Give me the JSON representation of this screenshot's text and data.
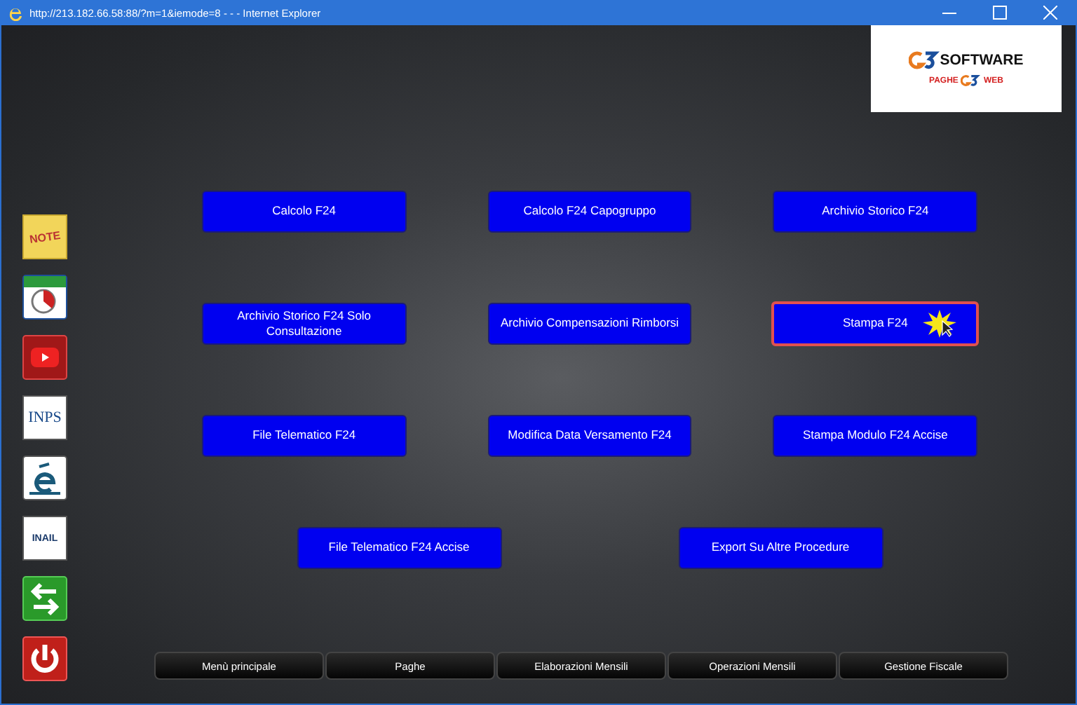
{
  "window": {
    "title": "http://213.182.66.58:88/?m=1&iemode=8 - - - Internet Explorer"
  },
  "logo": {
    "brand": "SOFTWARE",
    "left": "PAGHE",
    "right": "WEB"
  },
  "sidebar": [
    {
      "kind": "note",
      "text": "NOTE"
    },
    {
      "kind": "calendar"
    },
    {
      "kind": "video"
    },
    {
      "kind": "inps",
      "text": "INPS"
    },
    {
      "kind": "e"
    },
    {
      "kind": "inail",
      "text": "INAIL"
    },
    {
      "kind": "swap"
    },
    {
      "kind": "power"
    }
  ],
  "menu_rows": [
    [
      {
        "label": "Calcolo F24",
        "selected": false
      },
      {
        "label": "Calcolo F24 Capogruppo",
        "selected": false
      },
      {
        "label": "Archivio Storico F24",
        "selected": false
      }
    ],
    [
      {
        "label": "Archivio Storico F24 Solo Consultazione",
        "selected": false
      },
      {
        "label": "Archivio Compensazioni Rimborsi",
        "selected": false
      },
      {
        "label": "Stampa F24",
        "selected": true
      }
    ],
    [
      {
        "label": "File Telematico F24",
        "selected": false
      },
      {
        "label": "Modifica Data Versamento F24",
        "selected": false
      },
      {
        "label": "Stampa Modulo F24 Accise",
        "selected": false
      }
    ],
    [
      {
        "label": "File Telematico F24 Accise",
        "selected": false
      },
      {
        "label": "Export Su Altre Procedure",
        "selected": false
      }
    ]
  ],
  "bottom_nav": [
    "Menù principale",
    "Paghe",
    "Elaborazioni Mensili",
    "Operazioni Mensili",
    "Gestione Fiscale"
  ]
}
